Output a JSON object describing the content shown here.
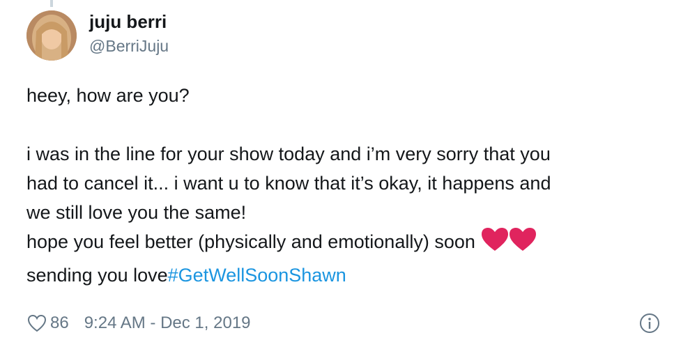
{
  "author": {
    "display_name": "juju berri",
    "handle": "@BerriJuju"
  },
  "tweet": {
    "line1": "heey, how are you?",
    "line2": "i was in the line for your show today and i’m very sorry that you",
    "line3": "had to cancel it... i want u to know that it’s okay, it happens and",
    "line4": "we still love you the same!",
    "line5": "hope you feel better (physically and emotionally) soon",
    "line6_text": "sending you love",
    "hashtag": "#GetWellSoonShawn",
    "emoji": "heart-icons"
  },
  "footer": {
    "like_count": "86",
    "timestamp": "9:24 AM - Dec 1, 2019"
  },
  "colors": {
    "text": "#14171a",
    "secondary": "#657786",
    "link": "#1b95e0",
    "heart": "#e0245e"
  }
}
